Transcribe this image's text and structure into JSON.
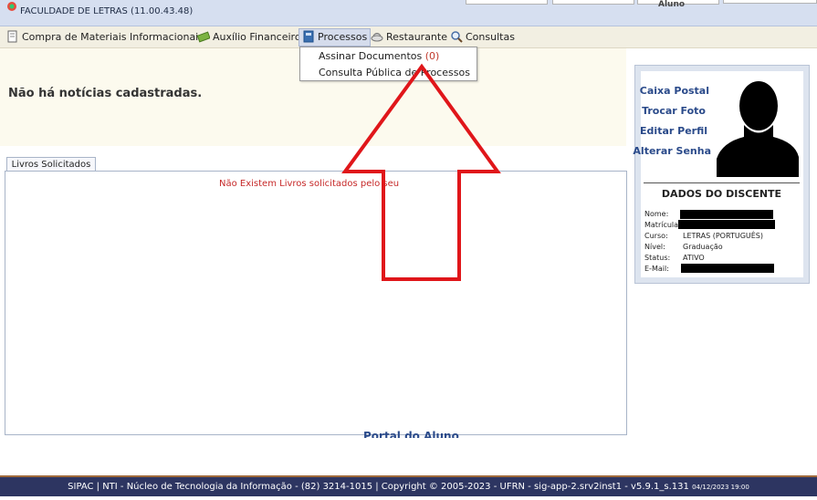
{
  "header": {
    "unit": "FACULDADE DE LETRAS (11.00.43.48)",
    "user_type": "Aluno"
  },
  "menu": {
    "items": [
      {
        "label": "Compra de Materiais Informacionais",
        "icon": "document-icon"
      },
      {
        "label": "Auxílio Financeiro",
        "icon": "money-icon"
      },
      {
        "label": "Processos",
        "icon": "folder-icon"
      },
      {
        "label": "Restaurante",
        "icon": "restaurant-icon"
      },
      {
        "label": "Consultas",
        "icon": "search-icon"
      }
    ],
    "dropdown": {
      "assinar_label": "Assinar Documentos",
      "assinar_count": "(0)",
      "consulta_label": "Consulta Pública de Processos"
    }
  },
  "news": {
    "message": "Não há notícias cadastradas."
  },
  "books": {
    "tab_label": "Livros Solicitados",
    "empty_message": "Não Existem Livros solicitados pelo seu"
  },
  "portal_link": "Portal do Aluno",
  "sidebar": {
    "links": [
      "Caixa Postal",
      "Trocar Foto",
      "Editar Perfil",
      "Alterar Senha"
    ],
    "section_title": "DADOS DO DISCENTE",
    "fields": [
      {
        "label": "Nome:",
        "value": ""
      },
      {
        "label": "Matrícula:",
        "value": ""
      },
      {
        "label": "Curso:",
        "value": "LETRAS (PORTUGUÊS)"
      },
      {
        "label": "Nível:",
        "value": "Graduação"
      },
      {
        "label": "Status:",
        "value": "ATIVO"
      },
      {
        "label": "E-Mail:",
        "value": ""
      }
    ]
  },
  "footer": {
    "text": "SIPAC | NTI - Núcleo de Tecnologia da Informação - (82) 3214-1015 | Copyright © 2005-2023 - UFRN - sig-app-2.srv2inst1 - v5.9.1_s.131",
    "timestamp": "04/12/2023 19:00"
  },
  "colors": {
    "footer_bg": "#2d3561",
    "menubar_bg": "#f2efe2",
    "link_blue": "#2a4a8a",
    "alert_red": "#c62828",
    "arrow_red": "#e0161a"
  }
}
